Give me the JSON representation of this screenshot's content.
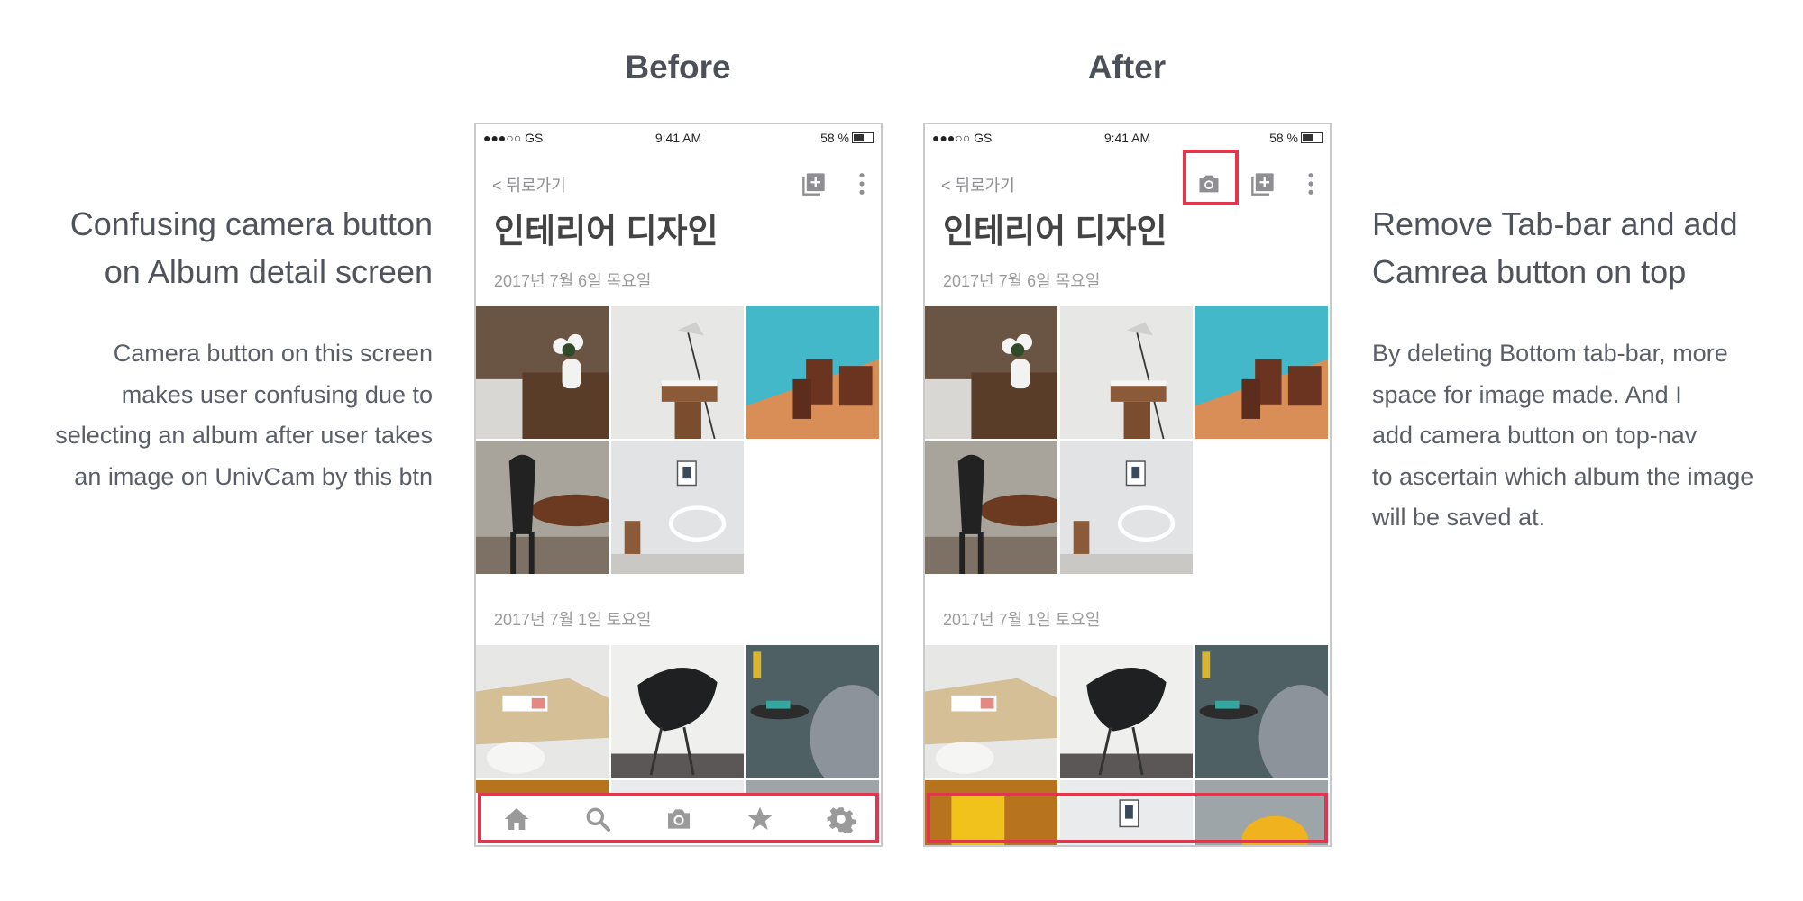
{
  "headings": {
    "before": "Before",
    "after": "After"
  },
  "left_note": {
    "title_lines": [
      "Confusing camera button",
      "on Album detail screen"
    ],
    "body_lines": [
      "Camera button on this screen",
      "makes user confusing due to",
      "selecting an album after user takes",
      "an image on UnivCam by this btn"
    ]
  },
  "right_note": {
    "title_lines": [
      "Remove Tab-bar and add",
      "Camrea button on top"
    ],
    "body_lines": [
      "By deleting Bottom tab-bar, more",
      "space for image made. And I",
      "add camera button on top-nav",
      "to ascertain which album the image",
      "will be saved at."
    ]
  },
  "phone": {
    "status": {
      "carrier": "●●●○○ GS",
      "time": "9:41 AM",
      "battery": "58 %"
    },
    "back_label": "< 뒤로가기",
    "album_title": "인테리어 디자인",
    "date_1": "2017년 7월 6일 목요일",
    "date_2": "2017년 7월 1일 토요일"
  },
  "tabbar_icons": [
    "home-icon",
    "search-icon",
    "camera-icon",
    "star-icon",
    "gear-icon"
  ],
  "colors": {
    "highlight": "#e0374f",
    "icon": "#9a9a9a"
  }
}
